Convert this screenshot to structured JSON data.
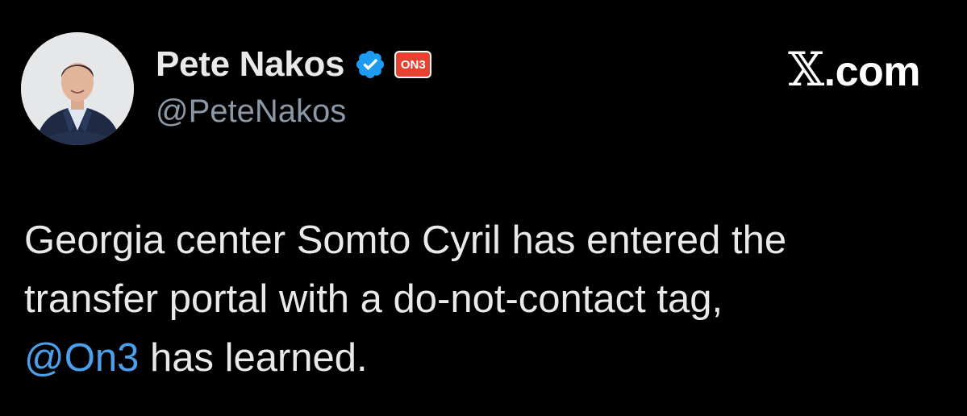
{
  "author": {
    "display_name": "Pete Nakos",
    "handle": "@PeteNakos",
    "verified": true,
    "verified_color": "#1d9bf0",
    "affiliate_badge_text": "ON3",
    "affiliate_badge_color": "#e8412f"
  },
  "watermark": {
    "x_logo": "𝕏",
    "domain": ".com"
  },
  "tweet": {
    "line1": "Georgia center Somto Cyril has entered the",
    "line2": "transfer portal with a do-not-contact tag,",
    "mention": "@On3",
    "line3_rest": " has learned.",
    "mention_color": "#4aa0ea"
  },
  "icons": {
    "avatar": "profile-photo",
    "verified": "verified-badge-icon",
    "affiliate": "on3-badge-icon"
  }
}
